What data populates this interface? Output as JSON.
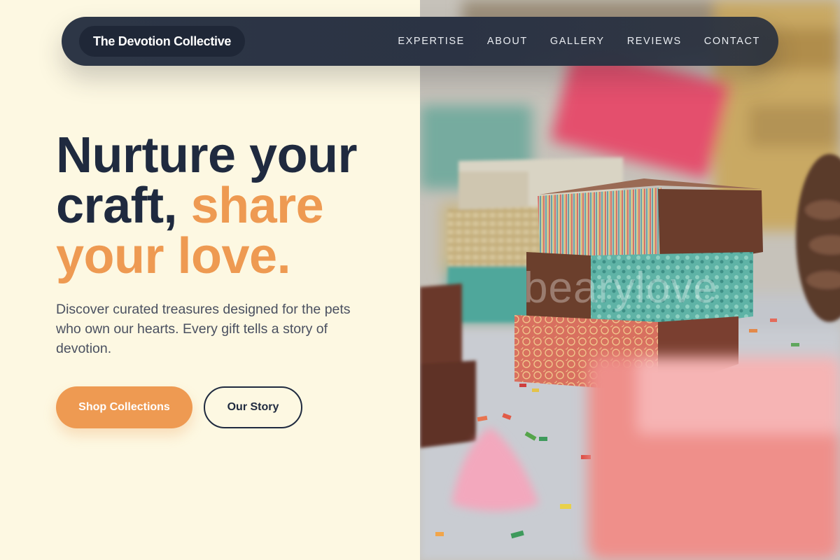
{
  "nav": {
    "brand": "The Devotion Collective",
    "links": [
      "EXPERTISE",
      "ABOUT",
      "GALLERY",
      "REVIEWS",
      "CONTACT"
    ]
  },
  "hero": {
    "headline_part1": "Nurture your craft,",
    "headline_accent": "share your love.",
    "subtext": "Discover curated treasures designed for the pets who own our hearts. Every gift tells a story of devotion.",
    "primary_button": "Shop Collections",
    "secondary_button": "Our Story",
    "image_watermark": "bearylove"
  },
  "colors": {
    "background": "#fdf8e2",
    "navbar": "#2d3646",
    "brand_pill": "#1f2737",
    "heading": "#1f2a3f",
    "accent": "#ee9a52",
    "body_text": "#4a5060"
  }
}
